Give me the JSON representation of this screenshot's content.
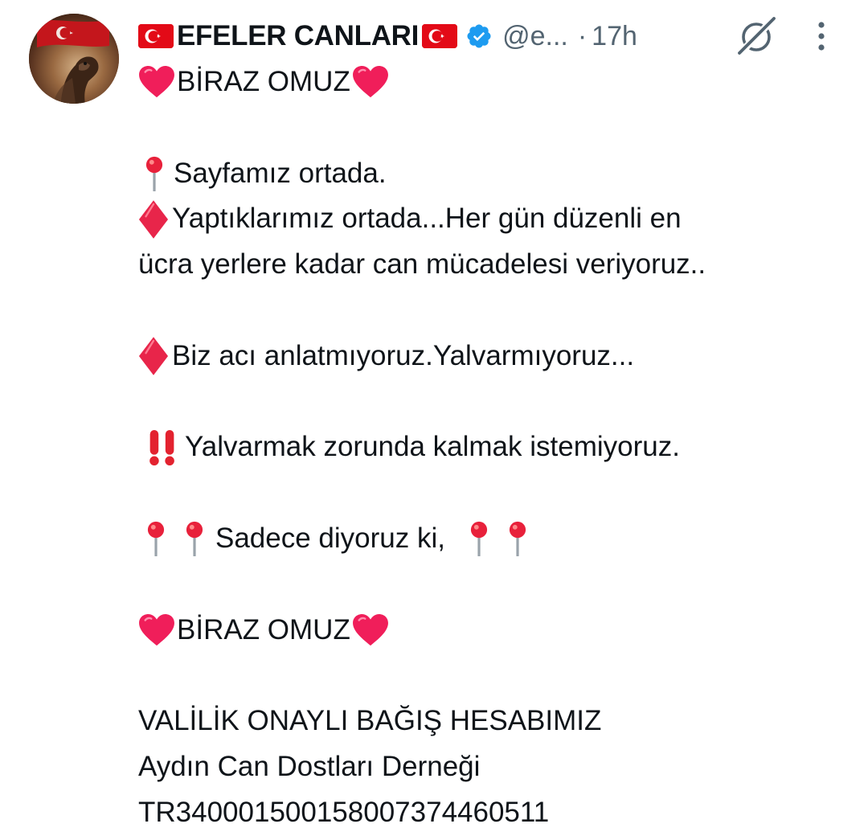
{
  "author": {
    "display_name": "EFELER CANLARI",
    "handle": "@e...",
    "separator": "·",
    "time": "17h",
    "verified_icon": "verified-badge-icon",
    "flag_icon": "turkey-flag-icon"
  },
  "icons": {
    "grok": "grok-icon",
    "more": "more-options-icon",
    "heart": "red-heart-emoji",
    "pin": "round-pushpin-emoji",
    "diamond": "red-diamond-emoji",
    "exclamation": "double-exclamation-emoji"
  },
  "colors": {
    "text": "#0f1419",
    "secondary": "#536471",
    "verified": "#1d9bf0",
    "heart": "#f01e5a",
    "diamond": "#e8254a",
    "flag": "#e30a17"
  },
  "tweet": {
    "l1": "BİRAZ OMUZ",
    "l3": "Sayfamız ortada.",
    "l4": "Yaptıklarımız ortada...Her gün düzenli en",
    "l5": "ücra yerlere kadar can mücadelesi veriyoruz..",
    "l7": "Biz acı anlatmıyoruz.Yalvarmıyoruz...",
    "l9": "Yalvarmak zorunda kalmak istemiyoruz.",
    "l11": "Sadece diyoruz ki,",
    "l13": "BİRAZ OMUZ",
    "l15": "VALİLİK ONAYLI BAĞIŞ HESABIMIZ",
    "l16": "Aydın Can Dostları Derneği",
    "l17": "TR340001500158007374460511"
  }
}
